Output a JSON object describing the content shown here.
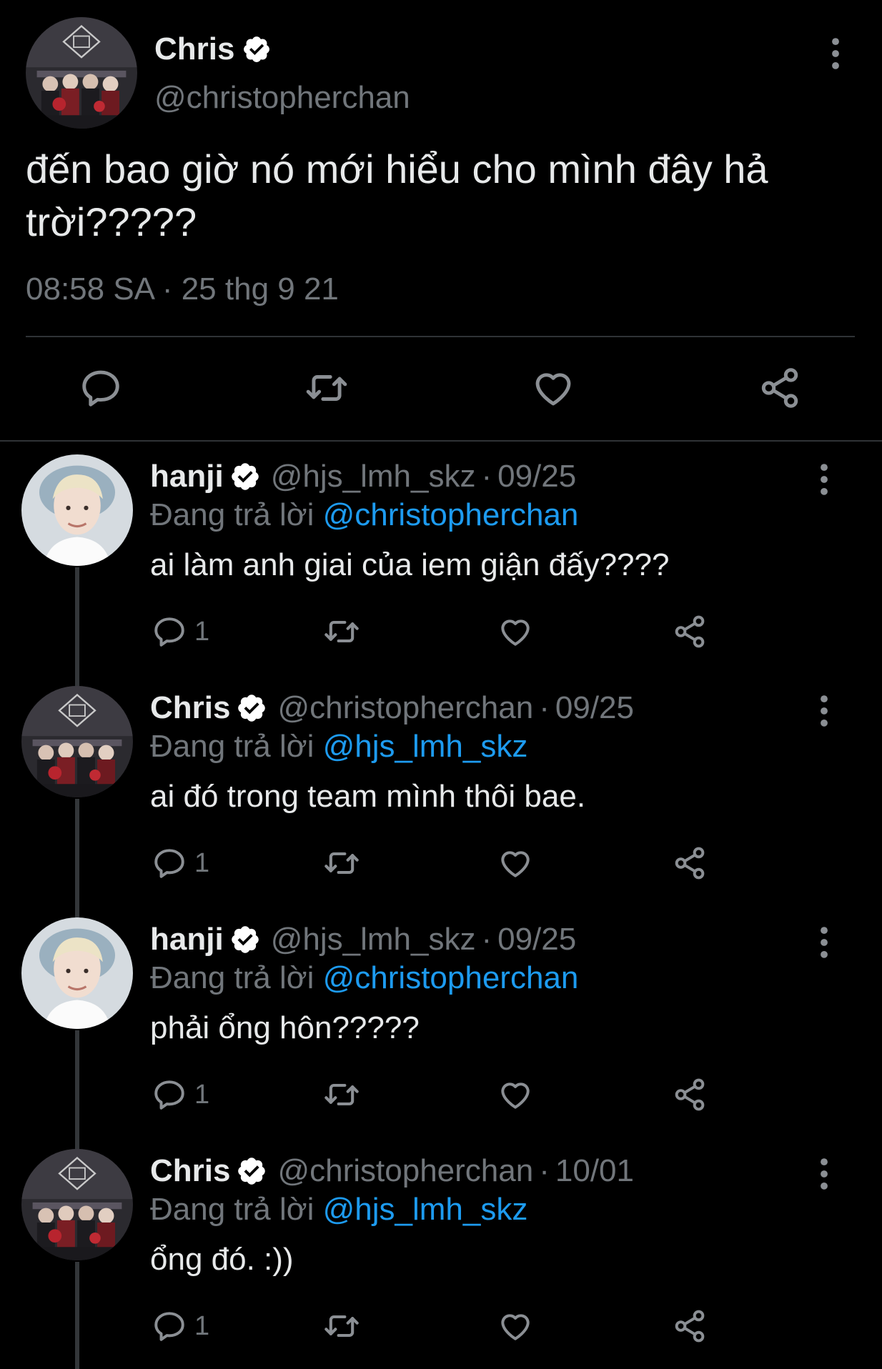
{
  "main_tweet": {
    "author_name": "Chris",
    "author_handle": "@christopherchan",
    "text": "đến bao giờ nó mới hiểu cho mình đây hả trời?????",
    "timestamp": "08:58 SA · 25 thg 9 21",
    "icons": [
      "verified-badge-icon",
      "more-icon",
      "reply-icon",
      "retweet-icon",
      "like-icon",
      "share-icon"
    ]
  },
  "replies": [
    {
      "author_name": "hanji",
      "author_handle": "@hjs_lmh_skz",
      "separator": "·",
      "date": "09/25",
      "replying_prefix": "Đang trả lời",
      "replying_to": "@christopherchan",
      "text": "ai làm anh giai của iem giận đấy????",
      "reply_count": "1"
    },
    {
      "author_name": "Chris",
      "author_handle": "@christopherchan",
      "separator": "·",
      "date": "09/25",
      "replying_prefix": "Đang trả lời",
      "replying_to": "@hjs_lmh_skz",
      "text": "ai đó trong team mình thôi bae.",
      "reply_count": "1"
    },
    {
      "author_name": "hanji",
      "author_handle": "@hjs_lmh_skz",
      "separator": "·",
      "date": "09/25",
      "replying_prefix": "Đang trả lời",
      "replying_to": "@christopherchan",
      "text": "phải ổng hôn?????",
      "reply_count": "1"
    },
    {
      "author_name": "Chris",
      "author_handle": "@christopherchan",
      "separator": "·",
      "date": "10/01",
      "replying_prefix": "Đang trả lời",
      "replying_to": "@hjs_lmh_skz",
      "text": "ổng đó. :))",
      "reply_count": "1"
    }
  ],
  "colors": {
    "background": "#000000",
    "primary_text": "#e7e9ea",
    "secondary_text": "#71767b",
    "mention": "#1d9bf0",
    "divider": "#2f3336"
  }
}
